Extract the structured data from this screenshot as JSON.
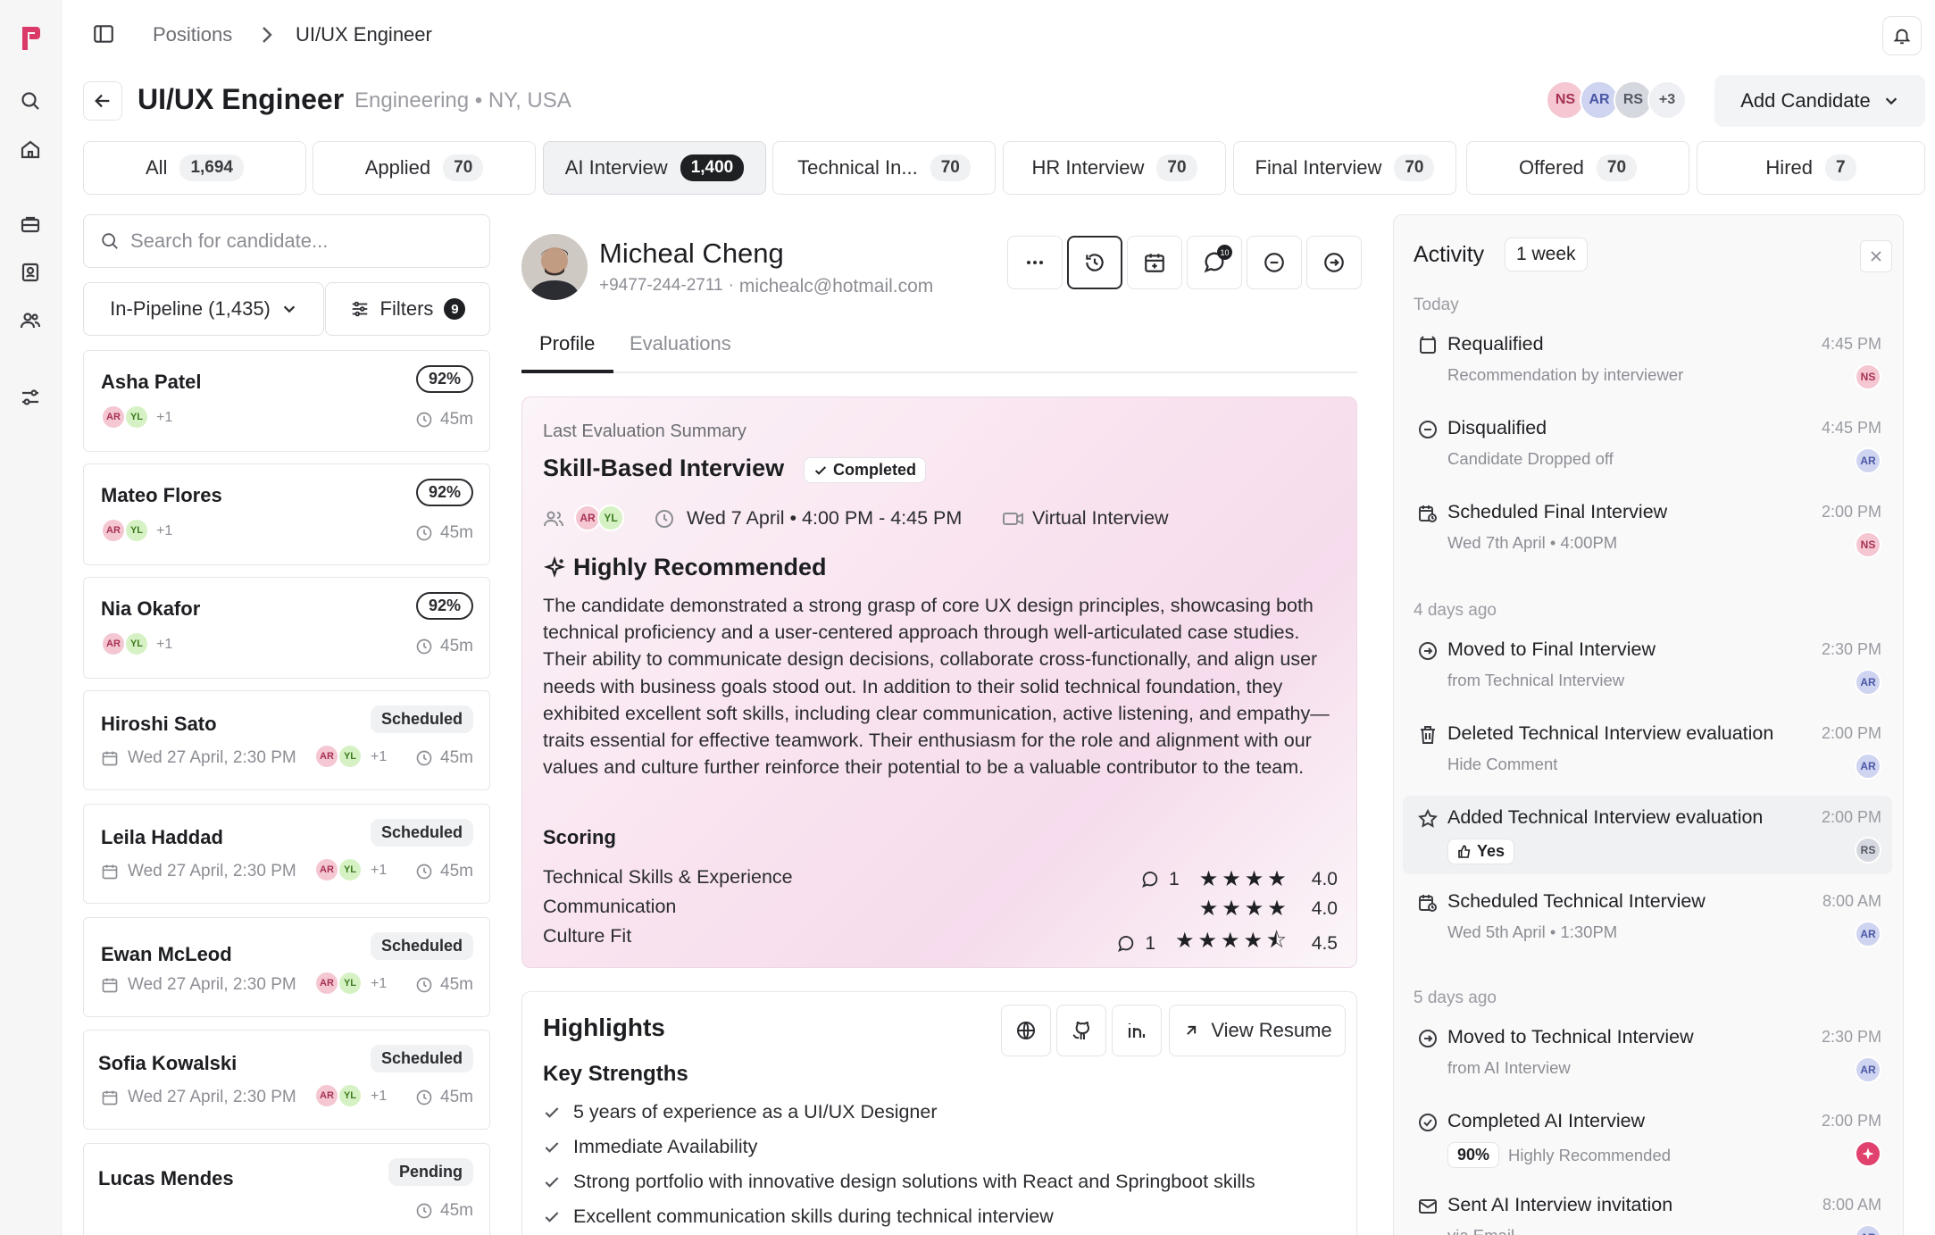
{
  "breadcrumb": {
    "parent": "Positions",
    "current": "UI/UX Engineer"
  },
  "header": {
    "title": "UI/UX Engineer",
    "subtitle": "Engineering • NY, USA",
    "team_avatars": [
      "NS",
      "AR",
      "RS"
    ],
    "team_more": "+3",
    "add_candidate": "Add Candidate"
  },
  "stages": [
    {
      "label": "All",
      "count": "1,694"
    },
    {
      "label": "Applied",
      "count": "70"
    },
    {
      "label": "AI Interview",
      "count": "1,400"
    },
    {
      "label": "Technical In...",
      "count": "70"
    },
    {
      "label": "HR Interview",
      "count": "70"
    },
    {
      "label": "Final Interview",
      "count": "70"
    },
    {
      "label": "Offered",
      "count": "70"
    },
    {
      "label": "Hired",
      "count": "7"
    }
  ],
  "list": {
    "search_placeholder": "Search for candidate...",
    "pipeline": "In-Pipeline (1,435)",
    "filters": "Filters",
    "filters_count": "9",
    "candidates": [
      {
        "name": "Asha Patel",
        "score": "92%",
        "av1": "AR",
        "av2": "YL",
        "more": "+1",
        "duration": "45m"
      },
      {
        "name": "Mateo Flores",
        "score": "92%",
        "av1": "AR",
        "av2": "YL",
        "more": "+1",
        "duration": "45m"
      },
      {
        "name": "Nia Okafor",
        "score": "92%",
        "av1": "AR",
        "av2": "YL",
        "more": "+1",
        "duration": "45m"
      },
      {
        "name": "Hiroshi Sato",
        "status": "Scheduled",
        "date": "Wed 27 April, 2:30 PM",
        "av1": "AR",
        "av2": "YL",
        "more": "+1",
        "duration": "45m"
      },
      {
        "name": "Leila Haddad",
        "status": "Scheduled",
        "date": "Wed 27 April, 2:30 PM",
        "av1": "AR",
        "av2": "YL",
        "more": "+1",
        "duration": "45m"
      },
      {
        "name": "Ewan McLeod",
        "status": "Scheduled",
        "date": "Wed 27 April, 2:30 PM",
        "av1": "AR",
        "av2": "YL",
        "more": "+1",
        "duration": "45m"
      },
      {
        "name": "Sofia Kowalski",
        "status": "Scheduled",
        "date": "Wed 27 April, 2:30 PM",
        "av1": "AR",
        "av2": "YL",
        "more": "+1",
        "duration": "45m"
      },
      {
        "name": "Lucas Mendes",
        "status": "Pending",
        "duration": "45m"
      }
    ]
  },
  "candidate": {
    "name": "Micheal Cheng",
    "phone": "+9477-244-2711",
    "email": "michealc@hotmail.com",
    "message_count": "10",
    "tabs": [
      "Profile",
      "Evaluations"
    ],
    "summary": {
      "label": "Last Evaluation Summary",
      "interview": "Skill-Based Interview",
      "status": "Completed",
      "av1": "AR",
      "av2": "YL",
      "datetime": "Wed 7 April • 4:00 PM - 4:45 PM",
      "mode": "Virtual Interview",
      "verdict": "Highly Recommended",
      "text": "The candidate demonstrated a strong grasp of core UX design principles, showcasing both technical proficiency and a user-centered approach through well-articulated case studies. Their ability to communicate design decisions, collaborate cross-functionally, and align user needs with business goals stood out. In addition to their solid technical foundation, they exhibited excellent soft skills, including clear communication, active listening, and empathy—traits essential for effective teamwork. Their enthusiasm for the role and alignment with our values and culture further reinforce their potential to be a valuable contributor to the team.",
      "scoring_title": "Scoring",
      "scores": [
        {
          "label": "Technical Skills & Experience",
          "comments": "1",
          "rating": 4.0,
          "value": "4.0"
        },
        {
          "label": "Communication",
          "comments": "",
          "rating": 4.0,
          "value": "4.0"
        },
        {
          "label": "Culture Fit",
          "comments": "1",
          "rating": 4.5,
          "value": "4.5"
        }
      ]
    },
    "highlights": {
      "title": "Highlights",
      "view_resume": "View Resume",
      "strengths_title": "Key Strengths",
      "strengths": [
        "5 years of experience as a UI/UX Designer",
        "Immediate Availability",
        "Strong portfolio with innovative design solutions with React and Springboot skills",
        "Excellent communication skills during technical interview"
      ]
    }
  },
  "activity": {
    "title": "Activity",
    "range": "1 week",
    "groups": [
      {
        "label": "Today"
      },
      {
        "label": "4 days ago"
      },
      {
        "label": "5 days ago"
      }
    ],
    "items": [
      {
        "title": "Requalified",
        "sub": "Recommendation by interviewer",
        "time": "4:45 PM",
        "av": "NS"
      },
      {
        "title": "Disqualified",
        "sub": "Candidate Dropped off",
        "time": "4:45 PM",
        "av": "AR"
      },
      {
        "title": "Scheduled Final Interview",
        "sub": "Wed 7th April • 4:00PM",
        "time": "2:00 PM",
        "av": "NS"
      },
      {
        "title": "Moved to Final Interview",
        "sub": "from Technical Interview",
        "time": "2:30 PM",
        "av": "AR"
      },
      {
        "title": "Deleted Technical Interview evaluation",
        "sub": "Hide Comment",
        "time": "2:00 PM",
        "av": "AR"
      },
      {
        "title": "Added Technical Interview evaluation",
        "sub": "Yes",
        "time": "2:00 PM",
        "av": "RS"
      },
      {
        "title": "Scheduled Technical Interview",
        "sub": "Wed 5th April • 1:30PM",
        "time": "8:00 AM",
        "av": "AR"
      },
      {
        "title": "Moved to Technical Interview",
        "sub": "from AI Interview",
        "time": "2:30 PM",
        "av": "AR"
      },
      {
        "title": "Completed AI Interview",
        "score": "90%",
        "sub": "Highly Recommended",
        "time": "2:00 PM"
      },
      {
        "title": "Sent AI Interview invitation",
        "sub": "via Email",
        "time": "8:00 AM",
        "av": "AR"
      }
    ]
  },
  "colors": {
    "brand": "#d93a67",
    "ai_badge": "#e0416d",
    "active_tab": "#1f2023"
  }
}
